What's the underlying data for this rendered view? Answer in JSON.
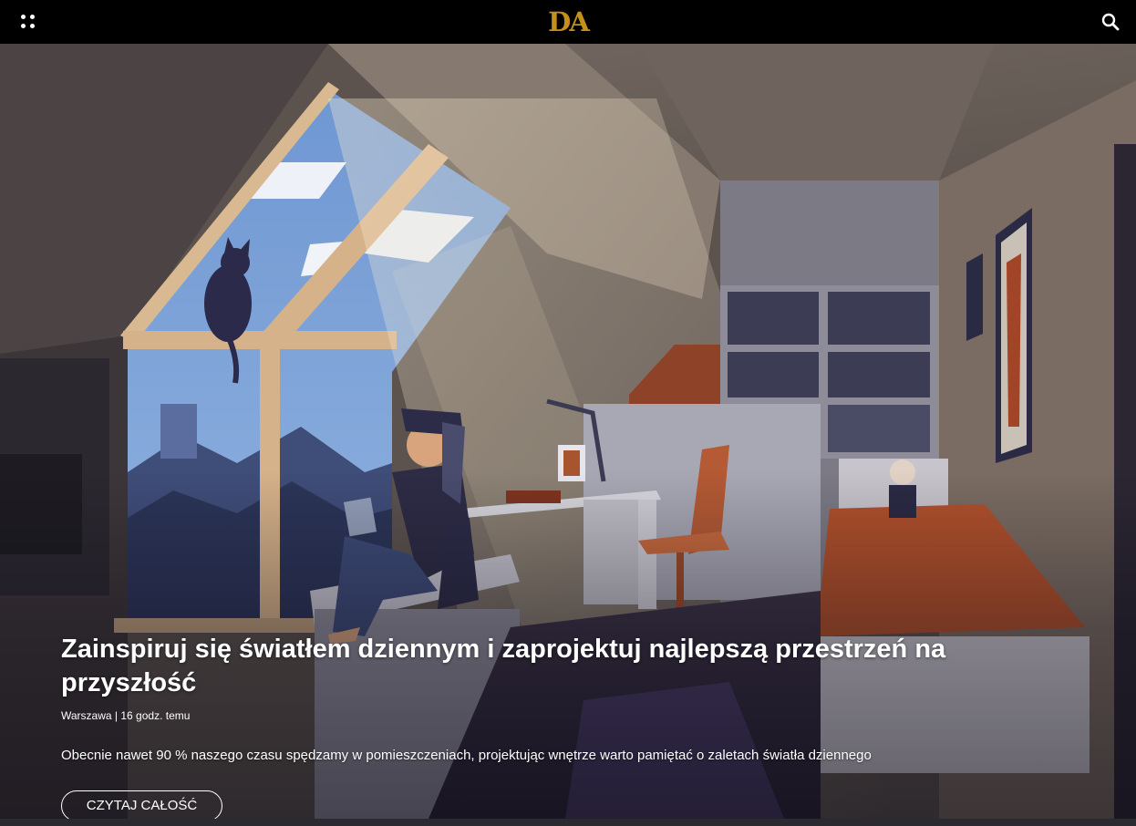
{
  "header": {
    "logo_text": "DA",
    "menu_icon": "dots-grid-icon",
    "search_icon": "search-icon",
    "logo_color": "#c48f1c"
  },
  "hero": {
    "title": "Zainspiruj się światłem dziennym i zaprojektuj najlepszą przestrzeń na przyszłość",
    "location": "Warszawa",
    "separator": "|",
    "time_ago": "16 godz. temu",
    "lead": "Obecnie nawet 90 % naszego czasu spędzamy w pomieszczeniach, projektując wnętrze warto pamiętać o zaletach światła dziennego",
    "button_label": "CZYTAJ CAŁOŚĆ"
  }
}
